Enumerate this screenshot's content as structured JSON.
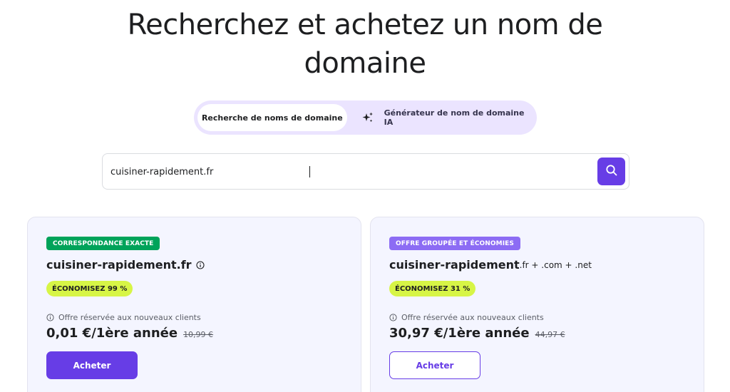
{
  "hero": {
    "title_line1": "Recherchez et achetez un nom de",
    "title_line2": "domaine"
  },
  "tabs": [
    {
      "label": "Recherche de noms de domaine",
      "active": true
    },
    {
      "label": "Générateur de nom de domaine IA",
      "active": false,
      "icon": "sparkle-icon"
    }
  ],
  "search": {
    "value": "cuisiner-rapidement.fr",
    "button_icon": "search-icon"
  },
  "cards": [
    {
      "badge": "CORRESPONDANCE EXACTE",
      "domain": "cuisiner-rapidement.fr",
      "domain_extra": "",
      "save": "ÉCONOMISEZ 99 %",
      "offer_note": "Offre réservée aux nouveaux clients",
      "price": "0,01 €/1ère année",
      "old_price": "10,99 €",
      "button": "Acheter"
    },
    {
      "badge": "OFFRE GROUPÉE ET ÉCONOMIES",
      "domain": "cuisiner-rapidement",
      "domain_extra": ".fr + .com + .net",
      "save": "ÉCONOMISEZ 31 %",
      "offer_note": "Offre réservée aux nouveaux clients",
      "price": "30,97 €/1ère année",
      "old_price": "44,97 €",
      "button": "Acheter"
    }
  ],
  "colors": {
    "accent": "#673de6",
    "badge_green": "#00a35a",
    "badge_purple": "#8c6cf4",
    "save_highlight": "#d7f546"
  }
}
